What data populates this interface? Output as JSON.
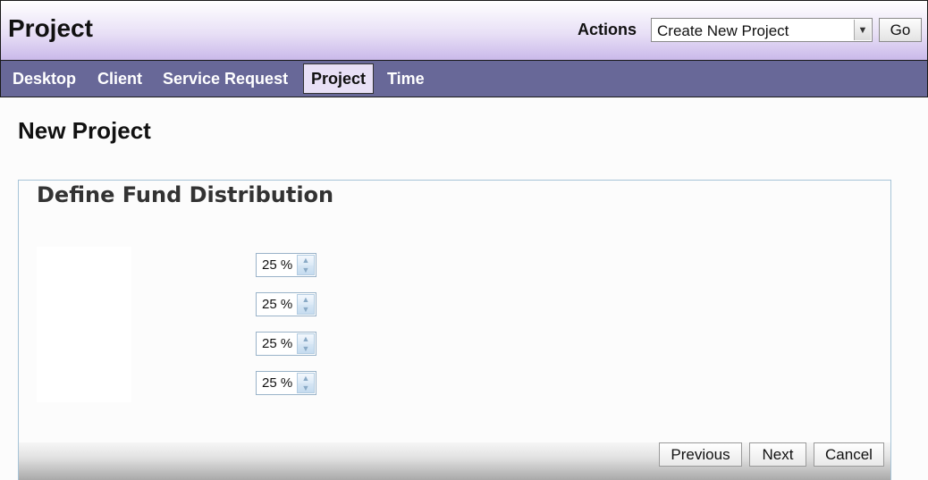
{
  "header": {
    "title": "Project",
    "actions_label": "Actions",
    "actions_select": {
      "selected": "Create New Project"
    },
    "go_label": "Go"
  },
  "nav": {
    "items": [
      {
        "label": "Desktop"
      },
      {
        "label": "Client"
      },
      {
        "label": "Service Request"
      },
      {
        "label": "Project",
        "active": true
      },
      {
        "label": "Time"
      }
    ]
  },
  "page": {
    "title": "New Project"
  },
  "fund_distribution": {
    "title": "Define Fund Distribution",
    "rows": [
      {
        "value": "25 %"
      },
      {
        "value": "25 %"
      },
      {
        "value": "25 %"
      },
      {
        "value": "25 %"
      }
    ]
  },
  "footer": {
    "previous_label": "Previous",
    "next_label": "Next",
    "cancel_label": "Cancel"
  },
  "colors": {
    "nav_background": "#686898",
    "header_gradient_end": "#cab9ea",
    "active_tab": "#e8e0f6",
    "panel_border": "#a7c4d8"
  }
}
